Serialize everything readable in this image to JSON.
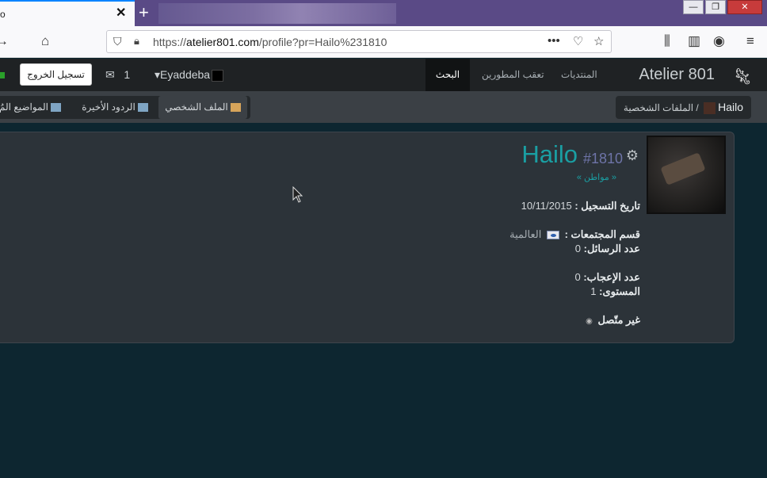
{
  "browser": {
    "tab_title": "o",
    "url_host": "atelier801.com",
    "url_prefix": "https://",
    "url_path": "/profile?pr=Hailo%231810"
  },
  "site": {
    "brand": "Atelier 801",
    "menu": {
      "forums": "المنتديات",
      "dev_tracker": "تعقب المطورين",
      "search": "البحث"
    },
    "user": {
      "name": "Eyaddeba",
      "messages": "1",
      "logout": "تسجيل الخروج"
    }
  },
  "subnav": {
    "breadcrumb_section": "الملفات الشخصية /",
    "breadcrumb_name": "Hailo",
    "tabs": [
      {
        "label": "الملف الشخصي"
      },
      {
        "label": "الردود الأخيرة"
      },
      {
        "label": "المواضيع المُ"
      }
    ]
  },
  "profile": {
    "name": "Hailo",
    "tag": "#1810",
    "title": "« مواطن »",
    "rows": {
      "registration_label": "تاريخ التسجيل :",
      "registration_value": "10/11/2015",
      "community_label": "قسم المجتمعات :",
      "community_value": "العالمية",
      "messages_label": "عدد الرسائل:",
      "messages_value": "0",
      "likes_label": "عدد الإعجاب:",
      "likes_value": "0",
      "level_label": "المستوى:",
      "level_value": "1",
      "status": "غير متّصل"
    }
  },
  "colors": {
    "accent": "#1a9fa3",
    "tag": "#6e74a8",
    "background": "#0d2630"
  }
}
